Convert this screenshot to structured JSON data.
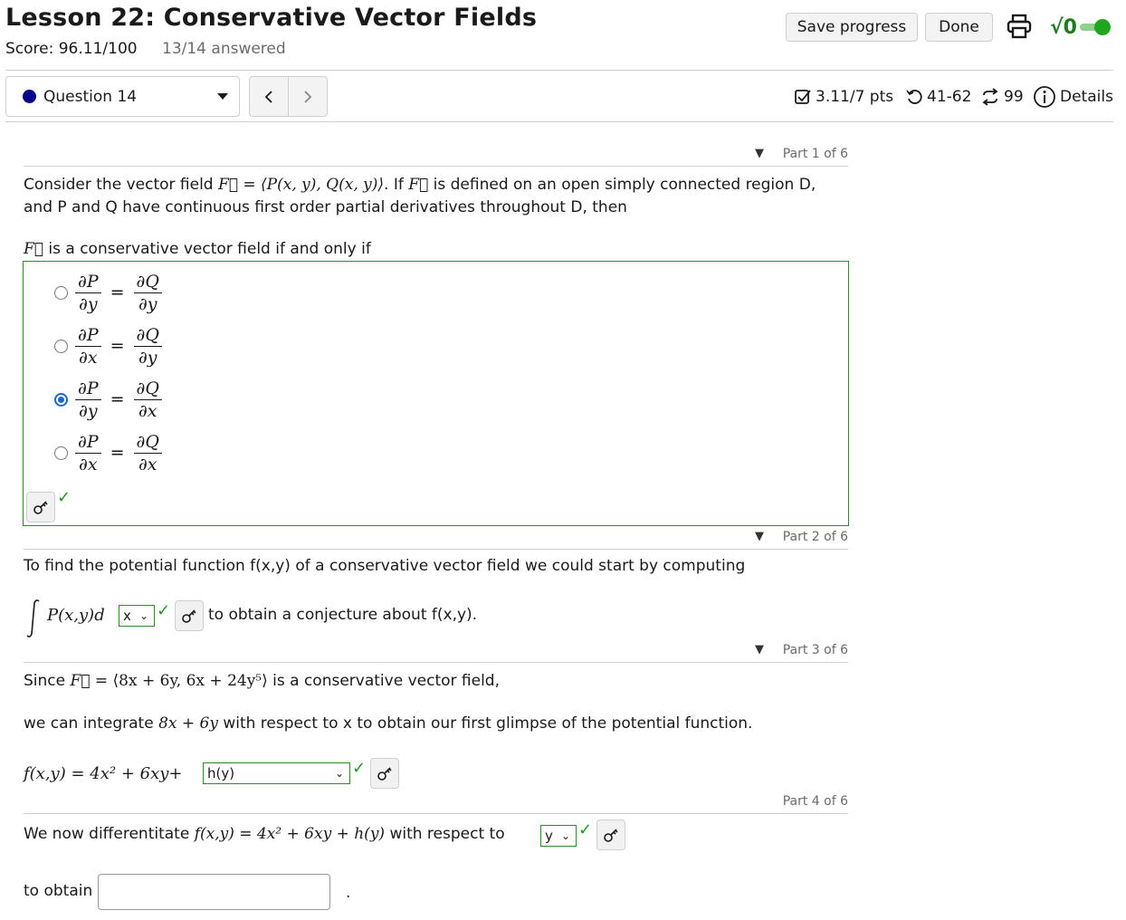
{
  "header": {
    "lesson_title": "Lesson 22: Conservative Vector Fields",
    "score": "Score: 96.11/100",
    "answered": "13/14 answered",
    "save_label": "Save progress",
    "done_label": "Done",
    "math_display_label": "√0",
    "math_display_on": true
  },
  "nav": {
    "question_label": "Question 14",
    "prev_label": "<",
    "next_label": ">",
    "points": "3.11/7 pts",
    "attempts": "41-62",
    "retries": "99",
    "details_label": "Details"
  },
  "part1": {
    "label": "Part 1 of 6",
    "intro_a": "Consider the vector field ",
    "intro_b": ". If ",
    "intro_c": " is defined on an open simply connected region D,",
    "intro_line2": "and P and Q have continuous first order partial derivatives throughout D, then",
    "prompt": " is a conservative vector field if and only if",
    "choices": [
      {
        "num_left": "∂P",
        "den_left": "∂y",
        "num_right": "∂Q",
        "den_right": "∂y",
        "selected": false
      },
      {
        "num_left": "∂P",
        "den_left": "∂x",
        "num_right": "∂Q",
        "den_right": "∂y",
        "selected": false
      },
      {
        "num_left": "∂P",
        "den_left": "∂y",
        "num_right": "∂Q",
        "den_right": "∂x",
        "selected": true
      },
      {
        "num_left": "∂P",
        "den_left": "∂x",
        "num_right": "∂Q",
        "den_right": "∂x",
        "selected": false
      }
    ],
    "check": "✓"
  },
  "part2": {
    "label": "Part 2 of 6",
    "text": "To find the potential function f(x,y) of a conservative vector field we could start by computing",
    "integral_expr": "P(x,y)d",
    "select_value": "x",
    "after_text": "to obtain a conjecture about f(x,y).",
    "check": "✓"
  },
  "part3": {
    "label": "Part 3 of 6",
    "since": "Since ",
    "field_expr": " = ⟨8x + 6y, 6x + 24y⁵⟩",
    "since_after": " is a conservative vector field,",
    "integrate_a": "we can integrate ",
    "integrate_expr": "8x + 6y",
    "integrate_b": " with respect to x to obtain our first glimpse of the potential function.",
    "f_expr": "f(x,y) = 4x² + 6xy+",
    "select_value": "h(y)",
    "check": "✓"
  },
  "part4": {
    "label": "Part 4 of 6",
    "diff_a": "We now differentitate ",
    "diff_expr": "f(x,y) = 4x² + 6xy + h(y)",
    "diff_b": " with respect to ",
    "select_value": "y",
    "check": "✓",
    "obtain_label": "to obtain",
    "obtain_value": "",
    "period": "."
  }
}
